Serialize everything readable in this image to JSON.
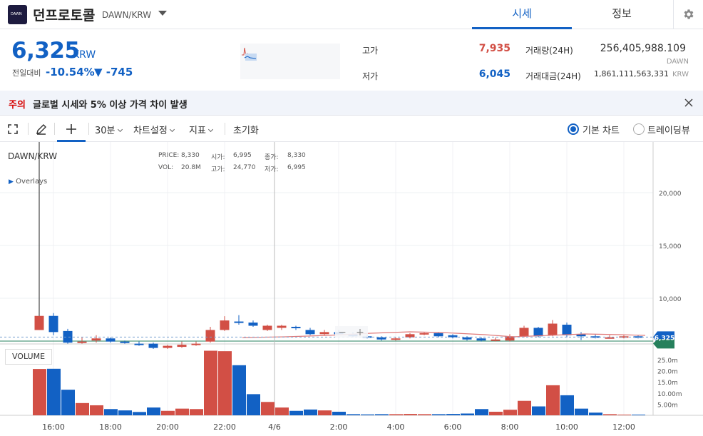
{
  "header": {
    "logo_text": "DAWN",
    "coin_name": "던프로토콜",
    "pair": "DAWN/KRW",
    "tabs": [
      {
        "label": "시세"
      },
      {
        "label": "정보"
      }
    ]
  },
  "price": {
    "current": "6,325",
    "unit": "KRW",
    "change_label": "전일대비",
    "change_rate": "-10.54%",
    "change_amount": "▼ -745"
  },
  "stats": {
    "high_label": "고가",
    "high": "7,935",
    "low_label": "저가",
    "low": "6,045",
    "volume_label": "거래량(24H)",
    "volume": "256,405,988.109",
    "volume_unit": "DAWN",
    "value_label": "거래대금(24H)",
    "value": "1,861,111,563,331",
    "value_unit": "KRW"
  },
  "notice": {
    "tag": "주의",
    "text": "글로벌 시세와 5% 이상 가격 차이 발생"
  },
  "toolbar": {
    "interval": "30분",
    "chart_settings": "차트설정",
    "indicators": "지표",
    "reset": "초기화",
    "basic_chart": "기본 차트",
    "tradingview": "트레이딩뷰"
  },
  "chart_legend": {
    "pair": "DAWN/KRW",
    "price_label": "PRICE:",
    "price": "8,330",
    "open_label": "시가:",
    "open": "6,995",
    "close_label": "종가:",
    "close": "8,330",
    "vol_label": "VOL:",
    "vol": "20.8M",
    "high_label": "고가:",
    "high": "24,770",
    "low_label": "저가:",
    "low": "6,995",
    "overlays": "Overlays",
    "volume_tag": "VOLUME",
    "current_tag": "6,325",
    "zoom_out": "−",
    "zoom_in": "+"
  },
  "colors": {
    "up": "#d24f45",
    "down": "#1261c4",
    "accent": "#1261c4"
  },
  "chart_data": {
    "type": "candlestick",
    "price_axis": {
      "ticks": [
        "20,000",
        "15,000",
        "10,000"
      ],
      "values": [
        20000,
        15000,
        10000
      ],
      "range": [
        5600,
        23500
      ]
    },
    "volume_axis": {
      "ticks": [
        "25.0m",
        "20.0m",
        "15.0m",
        "10.00m",
        "5.00m"
      ],
      "values": [
        25,
        20,
        15,
        10,
        5
      ],
      "range": [
        0,
        30
      ]
    },
    "x_ticks": [
      "16:00",
      "18:00",
      "20:00",
      "22:00",
      "4/6",
      "2:00",
      "4:00",
      "6:00",
      "8:00",
      "10:00",
      "12:00"
    ],
    "candles": [
      {
        "o": 6995,
        "c": 8330,
        "h": 24770,
        "l": 6995,
        "v": 20.8
      },
      {
        "o": 8330,
        "c": 6800,
        "h": 8600,
        "l": 6500,
        "v": 20.9
      },
      {
        "o": 6900,
        "c": 5800,
        "h": 7100,
        "l": 5700,
        "v": 11.5
      },
      {
        "o": 5800,
        "c": 5900,
        "h": 6300,
        "l": 5700,
        "v": 5.5
      },
      {
        "o": 6000,
        "c": 6200,
        "h": 6500,
        "l": 5800,
        "v": 4.5
      },
      {
        "o": 6200,
        "c": 5900,
        "h": 6300,
        "l": 5800,
        "v": 2.8
      },
      {
        "o": 5900,
        "c": 5800,
        "h": 6000,
        "l": 5700,
        "v": 2.2
      },
      {
        "o": 5700,
        "c": 5600,
        "h": 5900,
        "l": 5500,
        "v": 1.5
      },
      {
        "o": 5700,
        "c": 5300,
        "h": 5800,
        "l": 5200,
        "v": 3.5
      },
      {
        "o": 5300,
        "c": 5500,
        "h": 5600,
        "l": 5200,
        "v": 2.0
      },
      {
        "o": 5400,
        "c": 5600,
        "h": 5900,
        "l": 5300,
        "v": 3.0
      },
      {
        "o": 5600,
        "c": 5700,
        "h": 5900,
        "l": 5500,
        "v": 2.8
      },
      {
        "o": 5900,
        "c": 7000,
        "h": 7300,
        "l": 5800,
        "v": 29.0
      },
      {
        "o": 7000,
        "c": 7900,
        "h": 8300,
        "l": 6900,
        "v": 28.8
      },
      {
        "o": 7800,
        "c": 7700,
        "h": 8400,
        "l": 7500,
        "v": 22.5
      },
      {
        "o": 7700,
        "c": 7400,
        "h": 7900,
        "l": 7300,
        "v": 9.5
      },
      {
        "o": 7000,
        "c": 7400,
        "h": 7500,
        "l": 6900,
        "v": 6.0
      },
      {
        "o": 7200,
        "c": 7400,
        "h": 7500,
        "l": 7000,
        "v": 3.5
      },
      {
        "o": 7300,
        "c": 7200,
        "h": 7400,
        "l": 7000,
        "v": 2.0
      },
      {
        "o": 7000,
        "c": 6600,
        "h": 7200,
        "l": 6500,
        "v": 2.6
      },
      {
        "o": 6600,
        "c": 6800,
        "h": 7000,
        "l": 6500,
        "v": 2.2
      },
      {
        "o": 6800,
        "c": 6600,
        "h": 7000,
        "l": 6500,
        "v": 1.6
      },
      {
        "o": 6600,
        "c": 6400,
        "h": 6800,
        "l": 6300,
        "v": 0.5
      },
      {
        "o": 6400,
        "c": 6300,
        "h": 6500,
        "l": 6200,
        "v": 0.4
      },
      {
        "o": 6300,
        "c": 6100,
        "h": 6400,
        "l": 6000,
        "v": 0.5
      },
      {
        "o": 6100,
        "c": 6200,
        "h": 6300,
        "l": 6000,
        "v": 0.5
      },
      {
        "o": 6300,
        "c": 6600,
        "h": 6700,
        "l": 6200,
        "v": 0.6
      },
      {
        "o": 6600,
        "c": 6700,
        "h": 6800,
        "l": 6500,
        "v": 0.5
      },
      {
        "o": 6700,
        "c": 6400,
        "h": 6800,
        "l": 6300,
        "v": 0.5
      },
      {
        "o": 6500,
        "c": 6300,
        "h": 6600,
        "l": 6200,
        "v": 0.6
      },
      {
        "o": 6300,
        "c": 6100,
        "h": 6400,
        "l": 6000,
        "v": 0.8
      },
      {
        "o": 6200,
        "c": 6000,
        "h": 6300,
        "l": 5900,
        "v": 2.8
      },
      {
        "o": 6000,
        "c": 6100,
        "h": 6300,
        "l": 5900,
        "v": 1.6
      },
      {
        "o": 6000,
        "c": 6400,
        "h": 6600,
        "l": 5900,
        "v": 2.5
      },
      {
        "o": 6400,
        "c": 7200,
        "h": 7400,
        "l": 6300,
        "v": 6.5
      },
      {
        "o": 7200,
        "c": 6400,
        "h": 7300,
        "l": 6300,
        "v": 4.0
      },
      {
        "o": 6500,
        "c": 7600,
        "h": 7935,
        "l": 6400,
        "v": 13.5
      },
      {
        "o": 7500,
        "c": 6500,
        "h": 7700,
        "l": 6300,
        "v": 9.0
      },
      {
        "o": 6600,
        "c": 6400,
        "h": 6800,
        "l": 6045,
        "v": 3.0
      },
      {
        "o": 6400,
        "c": 6300,
        "h": 6600,
        "l": 6200,
        "v": 1.2
      },
      {
        "o": 6300,
        "c": 6300,
        "h": 6500,
        "l": 6200,
        "v": 0.5
      },
      {
        "o": 6300,
        "c": 6400,
        "h": 6500,
        "l": 6200,
        "v": 0.3
      },
      {
        "o": 6400,
        "c": 6325,
        "h": 6500,
        "l": 6200,
        "v": 0.3
      }
    ]
  }
}
